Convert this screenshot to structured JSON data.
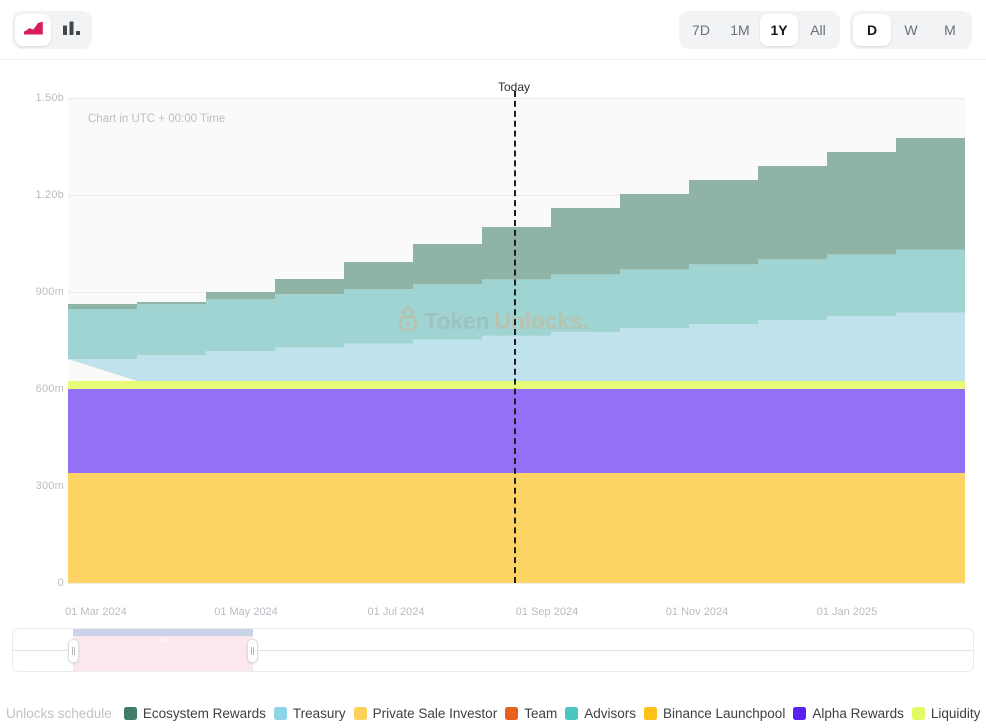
{
  "header": {
    "chart_type_buttons": [
      {
        "name": "area-chart-icon",
        "label": "Area chart",
        "active": true
      },
      {
        "name": "bar-chart-icon",
        "label": "Bar chart",
        "active": false
      }
    ],
    "range_buttons": [
      {
        "label": "7D",
        "active": false
      },
      {
        "label": "1M",
        "active": false
      },
      {
        "label": "1Y",
        "active": true
      },
      {
        "label": "All",
        "active": false
      }
    ],
    "interval_buttons": [
      {
        "label": "D",
        "active": true
      },
      {
        "label": "W",
        "active": false
      },
      {
        "label": "M",
        "active": false
      }
    ],
    "accent_color": "#d6205e"
  },
  "chart_notes": {
    "utc_note": "Chart in UTC + 00:00 Time",
    "today_label": "Today",
    "watermark_first": "Token",
    "watermark_second": "Unlocks."
  },
  "legend": {
    "title": "Unlocks schedule",
    "items": [
      {
        "label": "Ecosystem Rewards",
        "color": "#3f7e68"
      },
      {
        "label": "Treasury",
        "color": "#8dd4e8"
      },
      {
        "label": "Private Sale Investor",
        "color": "#ffd159"
      },
      {
        "label": "Team",
        "color": "#e8601f"
      },
      {
        "label": "Advisors",
        "color": "#4cc4c0"
      },
      {
        "label": "Binance Launchpool",
        "color": "#fcc018"
      },
      {
        "label": "Alpha Rewards",
        "color": "#5b20f0"
      },
      {
        "label": "Liquidity",
        "color": "#e0fb63"
      }
    ]
  },
  "slider": {
    "selection_start_pct": 6.4,
    "selection_end_pct": 24.0,
    "grip_marks": 3
  },
  "chart_data": {
    "type": "area",
    "subtype": "stacked-step",
    "title": "",
    "xlabel": "",
    "ylabel": "",
    "ylim": [
      0,
      1500000000
    ],
    "y_ticks": [
      0,
      300000000,
      600000000,
      900000000,
      1200000000,
      1500000000
    ],
    "y_tick_labels": [
      "0",
      "300m",
      "600m",
      "900m",
      "1.20b",
      "1.50b"
    ],
    "x_tick_labels": [
      "01 Mar 2024",
      "01 May 2024",
      "01 Jul 2024",
      "01 Sep 2024",
      "01 Nov 2024",
      "01 Jan 2025"
    ],
    "x_tick_positions_pct": [
      3.1,
      19.8,
      36.5,
      53.3,
      70.1,
      86.8
    ],
    "grid": true,
    "legend_position": "bottom",
    "today_marker_pct": 49.7,
    "x_steps": [
      "2024-02",
      "2024-03",
      "2024-04",
      "2024-05",
      "2024-06",
      "2024-07",
      "2024-08",
      "2024-09",
      "2024-10",
      "2024-11",
      "2024-12",
      "2025-01",
      "2025-02"
    ],
    "series": [
      {
        "name": "Private Sale Investor",
        "color": "#fdd464",
        "values": [
          340,
          340,
          340,
          340,
          340,
          340,
          340,
          340,
          340,
          340,
          340,
          340,
          340
        ]
      },
      {
        "name": "Alpha Rewards",
        "color": "#9370f5",
        "values": [
          260,
          260,
          260,
          260,
          260,
          260,
          260,
          260,
          260,
          260,
          260,
          260,
          260
        ]
      },
      {
        "name": "Liquidity",
        "color": "#e8fb76",
        "values": [
          25,
          25,
          25,
          25,
          25,
          25,
          25,
          25,
          25,
          25,
          25,
          25,
          25
        ]
      },
      {
        "name": "Treasury",
        "color": "#c0e2ec",
        "values": [
          68,
          80,
          92,
          104,
          116,
          128,
          140,
          152,
          164,
          176,
          188,
          200,
          212
        ]
      },
      {
        "name": "Advisors",
        "color": "#9fd4d2",
        "values": [
          62,
          76,
          90,
          104,
          118,
          132,
          146,
          160,
          174,
          188,
          202,
          216,
          195
        ]
      },
      {
        "name": "Ecosystem Rewards",
        "color": "#8fb3a4",
        "values": [
          15,
          40,
          72,
          110,
          148,
          190,
          232,
          275,
          318,
          360,
          403,
          445,
          345
        ]
      }
    ],
    "totals_millions": [
      770,
      821,
      879,
      943,
      1007,
      1100,
      1143,
      1212,
      1281,
      1349,
      1418,
      1486,
      1377
    ],
    "units": "millions of tokens"
  }
}
